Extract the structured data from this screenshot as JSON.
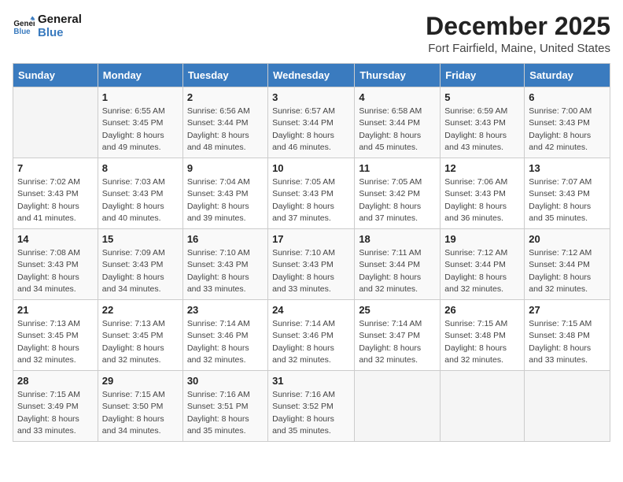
{
  "header": {
    "logo_line1": "General",
    "logo_line2": "Blue",
    "month": "December 2025",
    "location": "Fort Fairfield, Maine, United States"
  },
  "days_of_week": [
    "Sunday",
    "Monday",
    "Tuesday",
    "Wednesday",
    "Thursday",
    "Friday",
    "Saturday"
  ],
  "weeks": [
    [
      {
        "num": "",
        "info": ""
      },
      {
        "num": "1",
        "info": "Sunrise: 6:55 AM\nSunset: 3:45 PM\nDaylight: 8 hours\nand 49 minutes."
      },
      {
        "num": "2",
        "info": "Sunrise: 6:56 AM\nSunset: 3:44 PM\nDaylight: 8 hours\nand 48 minutes."
      },
      {
        "num": "3",
        "info": "Sunrise: 6:57 AM\nSunset: 3:44 PM\nDaylight: 8 hours\nand 46 minutes."
      },
      {
        "num": "4",
        "info": "Sunrise: 6:58 AM\nSunset: 3:44 PM\nDaylight: 8 hours\nand 45 minutes."
      },
      {
        "num": "5",
        "info": "Sunrise: 6:59 AM\nSunset: 3:43 PM\nDaylight: 8 hours\nand 43 minutes."
      },
      {
        "num": "6",
        "info": "Sunrise: 7:00 AM\nSunset: 3:43 PM\nDaylight: 8 hours\nand 42 minutes."
      }
    ],
    [
      {
        "num": "7",
        "info": "Sunrise: 7:02 AM\nSunset: 3:43 PM\nDaylight: 8 hours\nand 41 minutes."
      },
      {
        "num": "8",
        "info": "Sunrise: 7:03 AM\nSunset: 3:43 PM\nDaylight: 8 hours\nand 40 minutes."
      },
      {
        "num": "9",
        "info": "Sunrise: 7:04 AM\nSunset: 3:43 PM\nDaylight: 8 hours\nand 39 minutes."
      },
      {
        "num": "10",
        "info": "Sunrise: 7:05 AM\nSunset: 3:43 PM\nDaylight: 8 hours\nand 37 minutes."
      },
      {
        "num": "11",
        "info": "Sunrise: 7:05 AM\nSunset: 3:42 PM\nDaylight: 8 hours\nand 37 minutes."
      },
      {
        "num": "12",
        "info": "Sunrise: 7:06 AM\nSunset: 3:43 PM\nDaylight: 8 hours\nand 36 minutes."
      },
      {
        "num": "13",
        "info": "Sunrise: 7:07 AM\nSunset: 3:43 PM\nDaylight: 8 hours\nand 35 minutes."
      }
    ],
    [
      {
        "num": "14",
        "info": "Sunrise: 7:08 AM\nSunset: 3:43 PM\nDaylight: 8 hours\nand 34 minutes."
      },
      {
        "num": "15",
        "info": "Sunrise: 7:09 AM\nSunset: 3:43 PM\nDaylight: 8 hours\nand 34 minutes."
      },
      {
        "num": "16",
        "info": "Sunrise: 7:10 AM\nSunset: 3:43 PM\nDaylight: 8 hours\nand 33 minutes."
      },
      {
        "num": "17",
        "info": "Sunrise: 7:10 AM\nSunset: 3:43 PM\nDaylight: 8 hours\nand 33 minutes."
      },
      {
        "num": "18",
        "info": "Sunrise: 7:11 AM\nSunset: 3:44 PM\nDaylight: 8 hours\nand 32 minutes."
      },
      {
        "num": "19",
        "info": "Sunrise: 7:12 AM\nSunset: 3:44 PM\nDaylight: 8 hours\nand 32 minutes."
      },
      {
        "num": "20",
        "info": "Sunrise: 7:12 AM\nSunset: 3:44 PM\nDaylight: 8 hours\nand 32 minutes."
      }
    ],
    [
      {
        "num": "21",
        "info": "Sunrise: 7:13 AM\nSunset: 3:45 PM\nDaylight: 8 hours\nand 32 minutes."
      },
      {
        "num": "22",
        "info": "Sunrise: 7:13 AM\nSunset: 3:45 PM\nDaylight: 8 hours\nand 32 minutes."
      },
      {
        "num": "23",
        "info": "Sunrise: 7:14 AM\nSunset: 3:46 PM\nDaylight: 8 hours\nand 32 minutes."
      },
      {
        "num": "24",
        "info": "Sunrise: 7:14 AM\nSunset: 3:46 PM\nDaylight: 8 hours\nand 32 minutes."
      },
      {
        "num": "25",
        "info": "Sunrise: 7:14 AM\nSunset: 3:47 PM\nDaylight: 8 hours\nand 32 minutes."
      },
      {
        "num": "26",
        "info": "Sunrise: 7:15 AM\nSunset: 3:48 PM\nDaylight: 8 hours\nand 32 minutes."
      },
      {
        "num": "27",
        "info": "Sunrise: 7:15 AM\nSunset: 3:48 PM\nDaylight: 8 hours\nand 33 minutes."
      }
    ],
    [
      {
        "num": "28",
        "info": "Sunrise: 7:15 AM\nSunset: 3:49 PM\nDaylight: 8 hours\nand 33 minutes."
      },
      {
        "num": "29",
        "info": "Sunrise: 7:15 AM\nSunset: 3:50 PM\nDaylight: 8 hours\nand 34 minutes."
      },
      {
        "num": "30",
        "info": "Sunrise: 7:16 AM\nSunset: 3:51 PM\nDaylight: 8 hours\nand 35 minutes."
      },
      {
        "num": "31",
        "info": "Sunrise: 7:16 AM\nSunset: 3:52 PM\nDaylight: 8 hours\nand 35 minutes."
      },
      {
        "num": "",
        "info": ""
      },
      {
        "num": "",
        "info": ""
      },
      {
        "num": "",
        "info": ""
      }
    ]
  ]
}
